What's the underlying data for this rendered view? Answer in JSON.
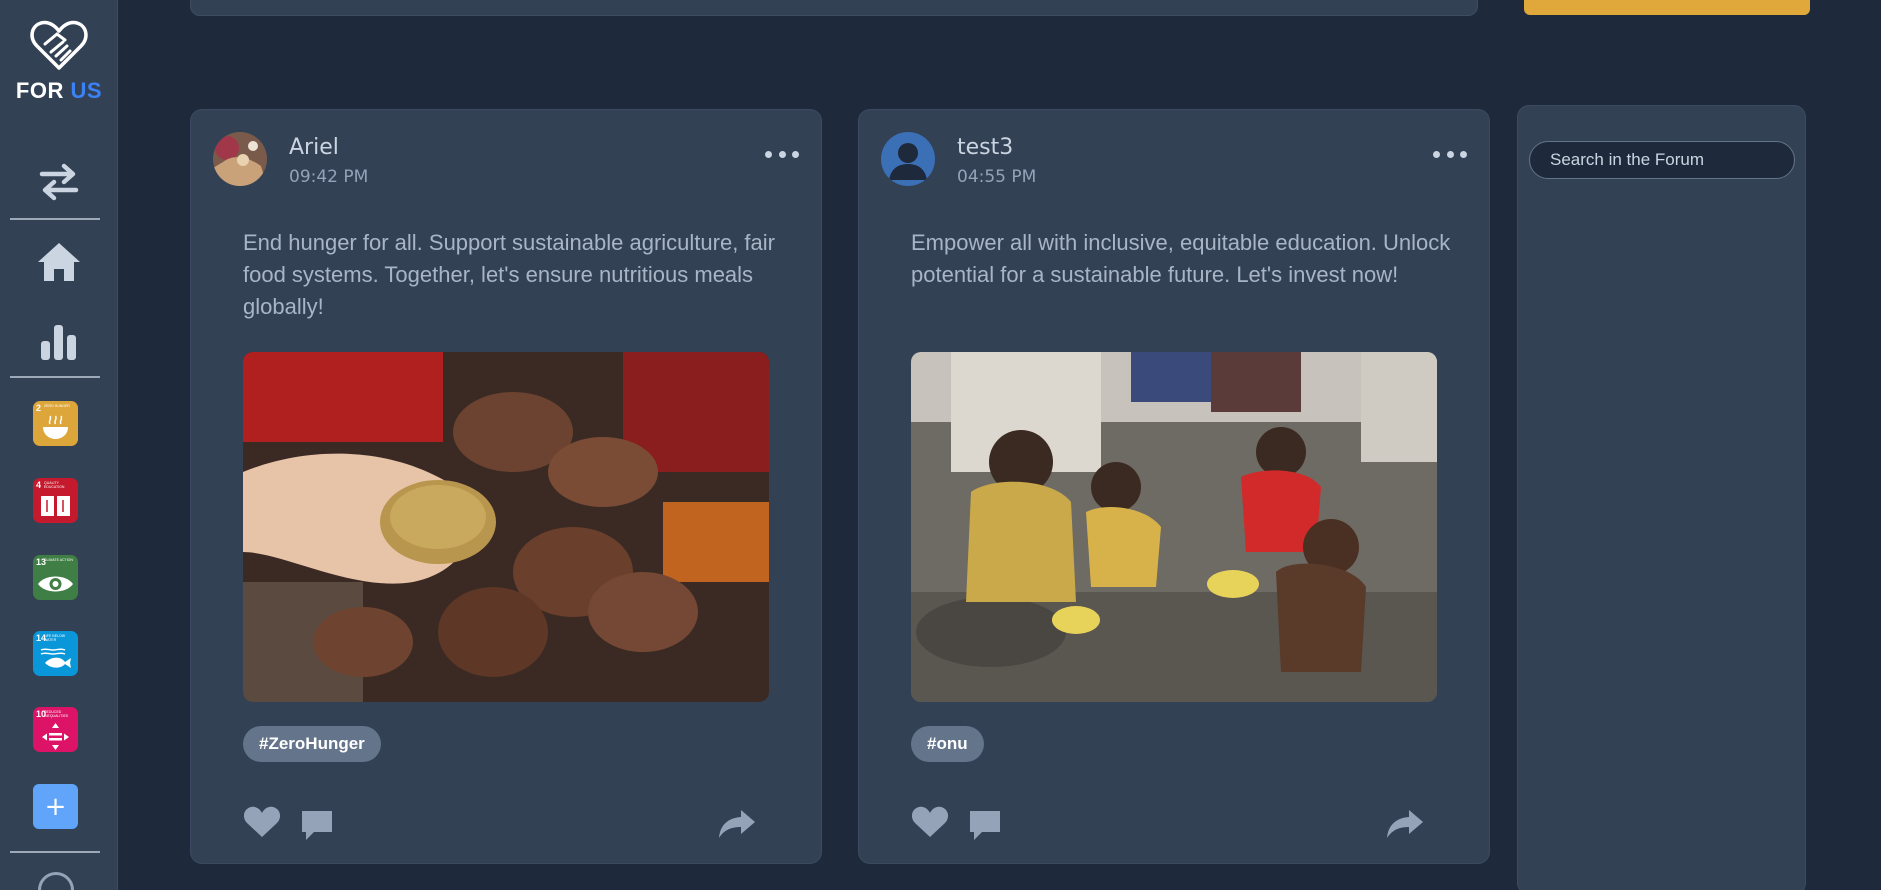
{
  "app": {
    "brand_word1": "FOR",
    "brand_word2": "US",
    "brand_icon": "heart-handshake-icon"
  },
  "sidebar": {
    "nav": [
      {
        "icon": "swap-arrows-icon"
      },
      {
        "icon": "home-icon"
      },
      {
        "icon": "bar-chart-icon"
      }
    ],
    "sdg_goals": [
      {
        "number": "2",
        "caption": "ZERO HUNGER",
        "color": "#dda63a",
        "icon": "bowl-icon"
      },
      {
        "number": "4",
        "caption": "QUALITY EDUCATION",
        "color": "#c5192d",
        "icon": "book-icon"
      },
      {
        "number": "13",
        "caption": "CLIMATE ACTION",
        "color": "#3f7e44",
        "icon": "eye-globe-icon"
      },
      {
        "number": "14",
        "caption": "LIFE BELOW WATER",
        "color": "#0a97d9",
        "icon": "fish-icon"
      },
      {
        "number": "10",
        "caption": "REDUCED INEQUALITIES",
        "color": "#dd1367",
        "icon": "equality-icon"
      }
    ],
    "add_label": "+"
  },
  "posts": [
    {
      "author": "Ariel",
      "time": "09:42 PM",
      "text": "End hunger for all. Support sustainable agriculture, fair food systems. Together, let's ensure nutritious meals globally!",
      "tag": "#ZeroHunger",
      "image": "hands-with-grain-photo"
    },
    {
      "author": "test3",
      "time": "04:55 PM",
      "text": "Empower all with inclusive, equitable education. Unlock potential for a sustainable future. Let's invest now!",
      "tag": "#onu",
      "image": "children-eating-photo"
    }
  ],
  "forum": {
    "search_placeholder": "Search in the Forum"
  },
  "colors": {
    "background": "#1e293b",
    "panel": "#334155",
    "accent_blue": "#3b82f6",
    "accent_yellow": "#e0a83a"
  }
}
